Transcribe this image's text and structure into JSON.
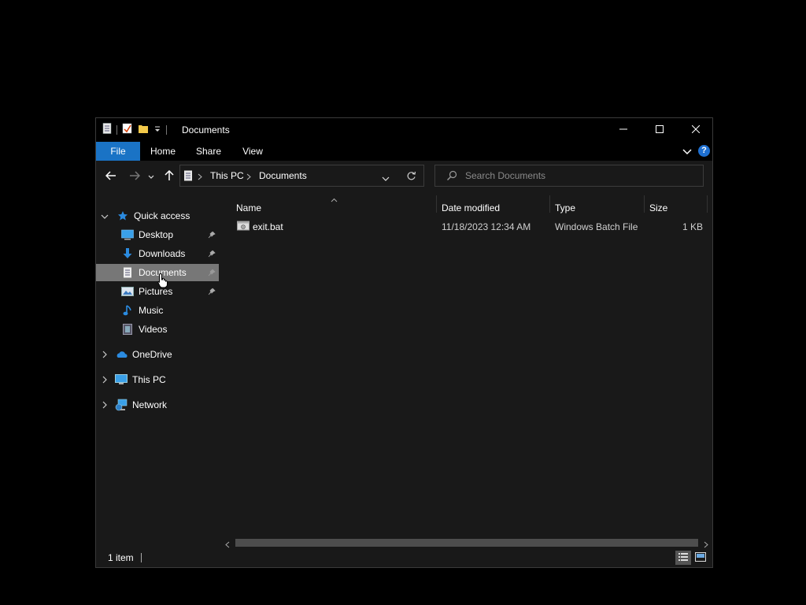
{
  "window": {
    "title": "Documents",
    "controls": [
      "minimize-icon",
      "maximize-icon",
      "close-icon"
    ]
  },
  "ribbon": {
    "tabs": [
      {
        "label": "File",
        "active": true
      },
      {
        "label": "Home"
      },
      {
        "label": "Share"
      },
      {
        "label": "View"
      }
    ],
    "accent": "#1a73c5"
  },
  "address": {
    "crumbs": [
      "This PC",
      "Documents"
    ]
  },
  "search": {
    "placeholder": "Search Documents"
  },
  "nav": {
    "quick_access": "Quick access",
    "pinned": [
      {
        "label": "Desktop",
        "icon": "desktop-icon",
        "pinned": true
      },
      {
        "label": "Downloads",
        "icon": "downloads-icon",
        "pinned": true
      },
      {
        "label": "Documents",
        "icon": "documents-icon",
        "pinned": true,
        "selected": true
      },
      {
        "label": "Pictures",
        "icon": "pictures-icon",
        "pinned": true
      },
      {
        "label": "Music",
        "icon": "music-icon"
      },
      {
        "label": "Videos",
        "icon": "videos-icon"
      }
    ],
    "roots": [
      {
        "label": "OneDrive",
        "icon": "onedrive-icon"
      },
      {
        "label": "This PC",
        "icon": "this-pc-icon"
      },
      {
        "label": "Network",
        "icon": "network-icon"
      }
    ]
  },
  "columns": [
    "Name",
    "Date modified",
    "Type",
    "Size"
  ],
  "files": [
    {
      "name": "exit.bat",
      "date": "11/18/2023 12:34 AM",
      "type": "Windows Batch File",
      "size": "1 KB"
    }
  ],
  "status": {
    "count": "1 item"
  }
}
